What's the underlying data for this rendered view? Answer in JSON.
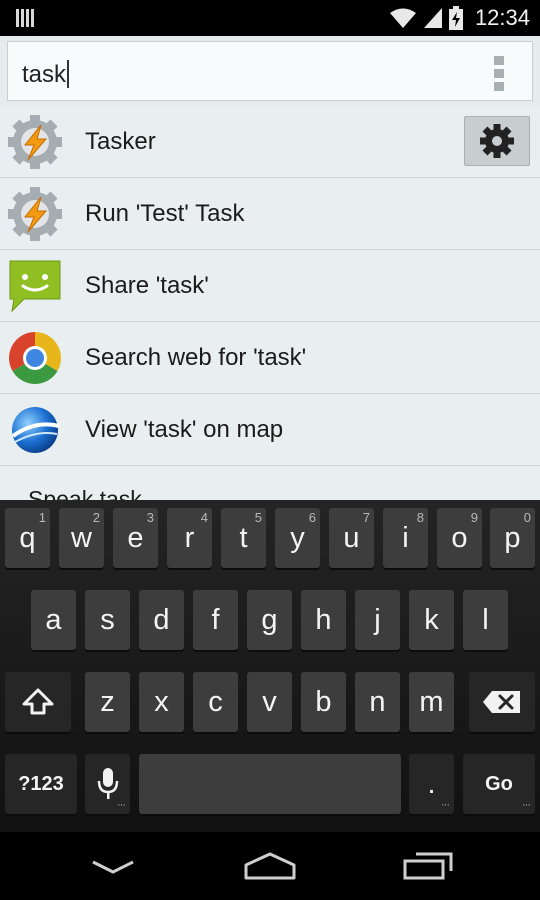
{
  "status_bar": {
    "time": "12:34",
    "icons": [
      "barcode-icon",
      "wifi-icon",
      "signal-icon",
      "battery-icon"
    ]
  },
  "search": {
    "query": "task",
    "menu_icon": "overflow-menu-icon"
  },
  "results": [
    {
      "label": "Tasker",
      "icon": "tasker-icon",
      "has_settings": true
    },
    {
      "label": "Run 'Test' Task",
      "icon": "tasker-icon"
    },
    {
      "label": "Share 'task'",
      "icon": "messaging-icon"
    },
    {
      "label": "Search web for 'task'",
      "icon": "chrome-icon"
    },
    {
      "label": "View 'task' on map",
      "icon": "google-earth-icon"
    },
    {
      "label": "Speak task",
      "icon": ""
    }
  ],
  "keyboard": {
    "row1": [
      {
        "k": "q",
        "h": "1"
      },
      {
        "k": "w",
        "h": "2"
      },
      {
        "k": "e",
        "h": "3"
      },
      {
        "k": "r",
        "h": "4"
      },
      {
        "k": "t",
        "h": "5"
      },
      {
        "k": "y",
        "h": "6"
      },
      {
        "k": "u",
        "h": "7"
      },
      {
        "k": "i",
        "h": "8"
      },
      {
        "k": "o",
        "h": "9"
      },
      {
        "k": "p",
        "h": "0"
      }
    ],
    "row2": [
      "a",
      "s",
      "d",
      "f",
      "g",
      "h",
      "j",
      "k",
      "l"
    ],
    "row3": [
      "z",
      "x",
      "c",
      "v",
      "b",
      "n",
      "m"
    ],
    "symbols_label": "?123",
    "period_label": ".",
    "go_label": "Go"
  },
  "colors": {
    "accent": "#33b5e5",
    "list_bg": "#e9eff0",
    "key_bg": "#3d3d3d"
  }
}
